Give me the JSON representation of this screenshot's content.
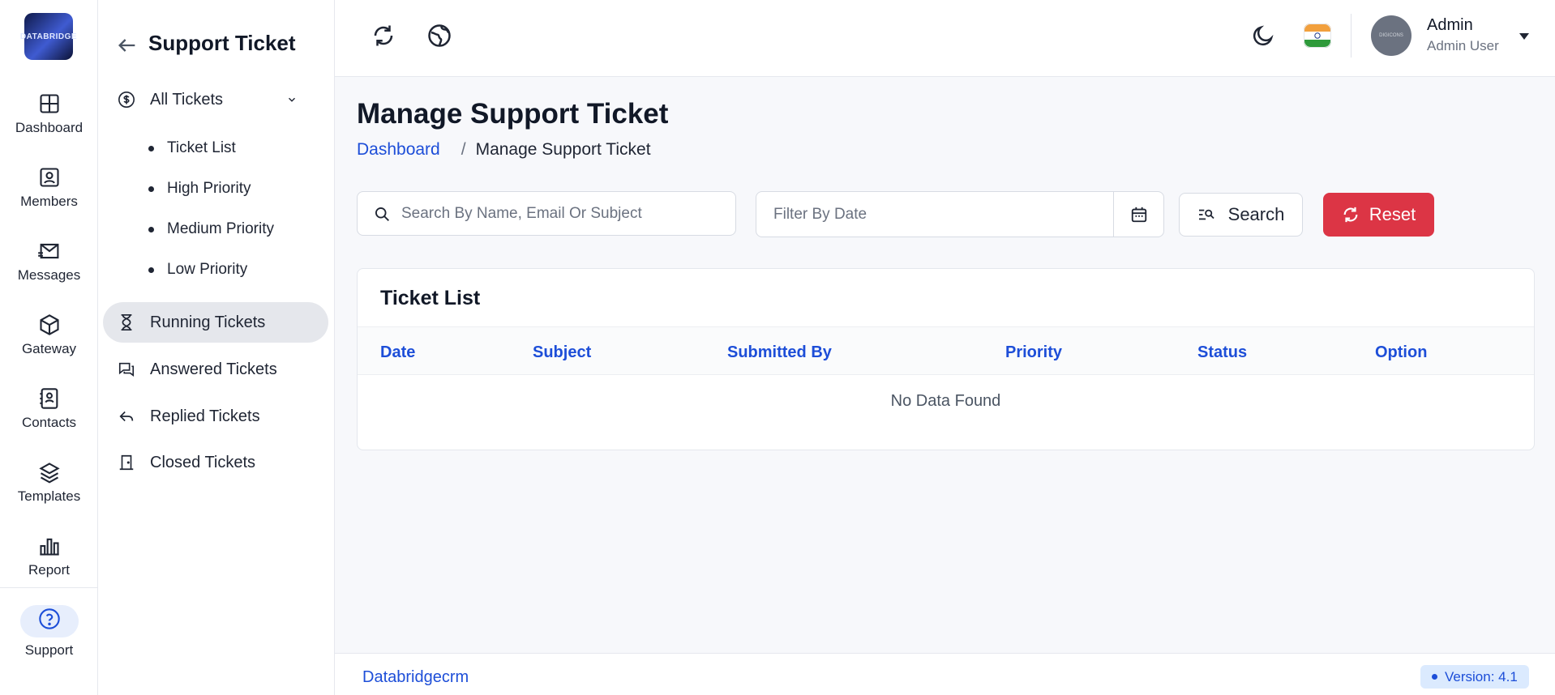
{
  "brand": {
    "logo_text": "DATABRIDGE"
  },
  "rail": {
    "items": [
      {
        "label": "Dashboard"
      },
      {
        "label": "Members"
      },
      {
        "label": "Messages"
      },
      {
        "label": "Gateway"
      },
      {
        "label": "Contacts"
      },
      {
        "label": "Templates"
      },
      {
        "label": "Report"
      }
    ],
    "support_label": "Support"
  },
  "subbar": {
    "title": "Support Ticket",
    "group_label": "All Tickets",
    "sub_items": [
      "Ticket List",
      "High Priority",
      "Medium Priority",
      "Low Priority"
    ],
    "menu": [
      "Running Tickets",
      "Answered Tickets",
      "Replied Tickets",
      "Closed Tickets"
    ]
  },
  "topbar": {
    "user_name": "Admin",
    "user_role": "Admin User",
    "avatar_text": "DIGICONS"
  },
  "page": {
    "title": "Manage Support Ticket",
    "breadcrumb": {
      "home": "Dashboard",
      "separator": "/",
      "current": "Manage Support Ticket"
    }
  },
  "filters": {
    "search_placeholder": "Search By Name, Email Or Subject",
    "date_placeholder": "Filter By Date",
    "search_label": "Search",
    "reset_label": "Reset"
  },
  "table": {
    "title": "Ticket List",
    "columns": [
      "Date",
      "Subject",
      "Submitted By",
      "Priority",
      "Status",
      "Option"
    ],
    "empty_text": "No Data Found"
  },
  "footer": {
    "brand": "Databridgecrm",
    "version": "Version: 4.1"
  },
  "colors": {
    "accent": "#1d4ed8",
    "danger": "#dc3545",
    "active_bg": "#e5e7ec"
  }
}
